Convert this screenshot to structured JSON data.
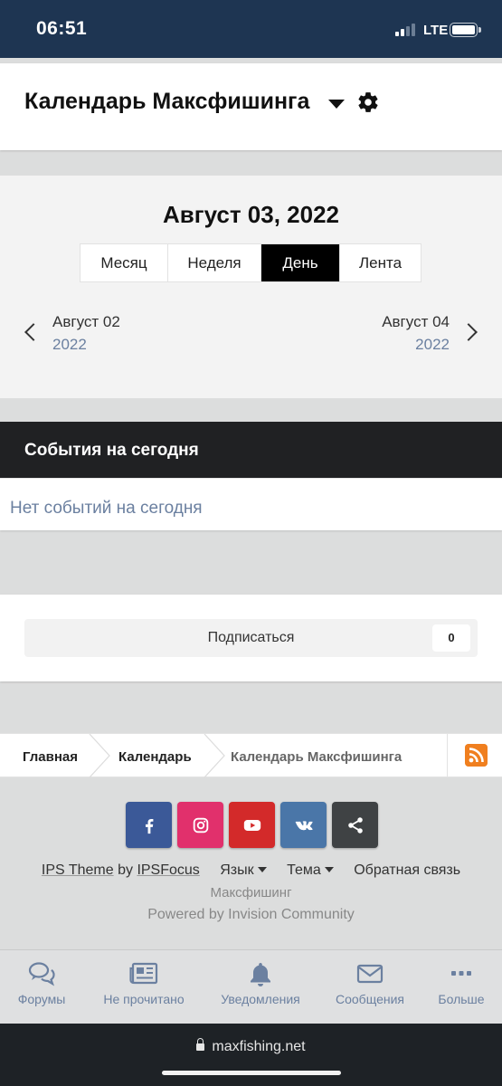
{
  "status_bar": {
    "time": "06:51",
    "network": "LTE"
  },
  "header": {
    "title": "Календарь Максфишинга",
    "caret_icon": "caret-down-icon",
    "settings_icon": "gear-icon"
  },
  "date_panel": {
    "heading": "Август 03, 2022",
    "tabs": [
      {
        "label": "Месяц",
        "active": false
      },
      {
        "label": "Неделя",
        "active": false
      },
      {
        "label": "День",
        "active": true
      },
      {
        "label": "Лента",
        "active": false
      }
    ],
    "prev": {
      "month": "Август 02",
      "year": "2022"
    },
    "next": {
      "month": "Август 04",
      "year": "2022"
    }
  },
  "events": {
    "title": "События на сегодня",
    "empty": "Нет событий на сегодня"
  },
  "subscribe": {
    "label": "Подписаться",
    "count": "0"
  },
  "breadcrumb": {
    "home": "Главная",
    "calendar": "Календарь",
    "current": "Календарь Максфишинга",
    "rss_icon": "rss-icon"
  },
  "social": [
    {
      "name": "facebook-icon",
      "color": "#3b5998"
    },
    {
      "name": "instagram-icon",
      "color": "#e1306c"
    },
    {
      "name": "youtube-icon",
      "color": "#d32a2a"
    },
    {
      "name": "vk-icon",
      "color": "#4a76a8"
    },
    {
      "name": "share-icon",
      "color": "#3f4244"
    }
  ],
  "footer": {
    "theme_prefix": "IPS Theme",
    "by": "by",
    "theme_author": "IPSFocus",
    "language": "Язык",
    "theme": "Тема",
    "feedback": "Обратная связь",
    "site_name": "Максфишинг",
    "powered": "Powered by Invision Community"
  },
  "bottom_nav": {
    "forums": "Форумы",
    "unread": "Не прочитано",
    "notifications": "Уведомления",
    "messages": "Сообщения",
    "more": "Больше"
  },
  "url_bar": {
    "url": "maxfishing.net"
  },
  "colors": {
    "status_bar": "#1e3552",
    "accent": "#6b80a0",
    "events_header": "#202123",
    "rss": "#f07f1f"
  }
}
